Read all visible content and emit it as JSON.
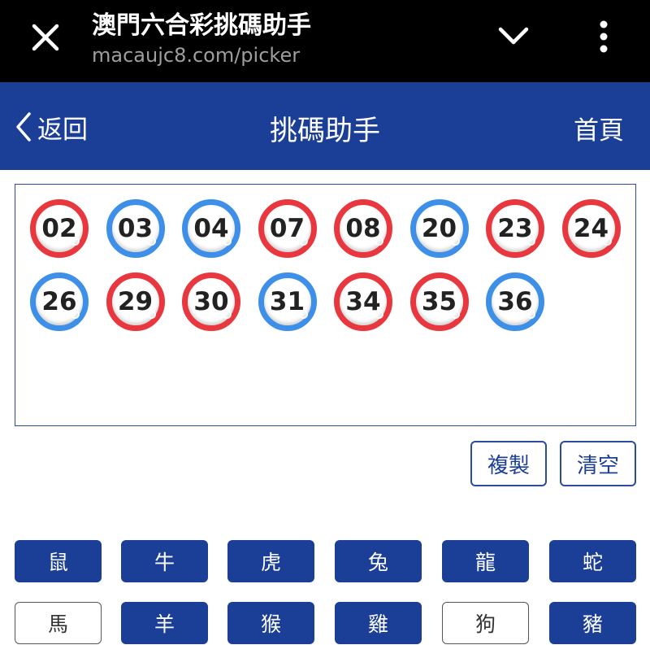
{
  "browser": {
    "title": "澳門六合彩挑碼助手",
    "url": "macaujc8.com/picker",
    "icons": [
      "close-icon",
      "chevron-down-icon",
      "more-vert-icon"
    ]
  },
  "header": {
    "back_label": "返回",
    "title": "挑碼助手",
    "home_label": "首頁",
    "color": "#1b3f97"
  },
  "colors": {
    "red_ball": "#e8373e",
    "blue_ball": "#3d8fe8",
    "primary": "#1b3f97"
  },
  "selected_numbers": [
    {
      "number": "02",
      "color": "red"
    },
    {
      "number": "03",
      "color": "blue"
    },
    {
      "number": "04",
      "color": "blue"
    },
    {
      "number": "07",
      "color": "red"
    },
    {
      "number": "08",
      "color": "red"
    },
    {
      "number": "20",
      "color": "blue"
    },
    {
      "number": "23",
      "color": "red"
    },
    {
      "number": "24",
      "color": "red"
    },
    {
      "number": "26",
      "color": "blue"
    },
    {
      "number": "29",
      "color": "red"
    },
    {
      "number": "30",
      "color": "red"
    },
    {
      "number": "31",
      "color": "blue"
    },
    {
      "number": "34",
      "color": "red"
    },
    {
      "number": "35",
      "color": "red"
    },
    {
      "number": "36",
      "color": "blue"
    }
  ],
  "actions": {
    "copy_label": "複製",
    "clear_label": "清空"
  },
  "zodiac": [
    {
      "label": "鼠",
      "selected": true
    },
    {
      "label": "牛",
      "selected": true
    },
    {
      "label": "虎",
      "selected": true
    },
    {
      "label": "兔",
      "selected": true
    },
    {
      "label": "龍",
      "selected": true
    },
    {
      "label": "蛇",
      "selected": true
    },
    {
      "label": "馬",
      "selected": false
    },
    {
      "label": "羊",
      "selected": true
    },
    {
      "label": "猴",
      "selected": true
    },
    {
      "label": "雞",
      "selected": true
    },
    {
      "label": "狗",
      "selected": false
    },
    {
      "label": "豬",
      "selected": true
    }
  ]
}
